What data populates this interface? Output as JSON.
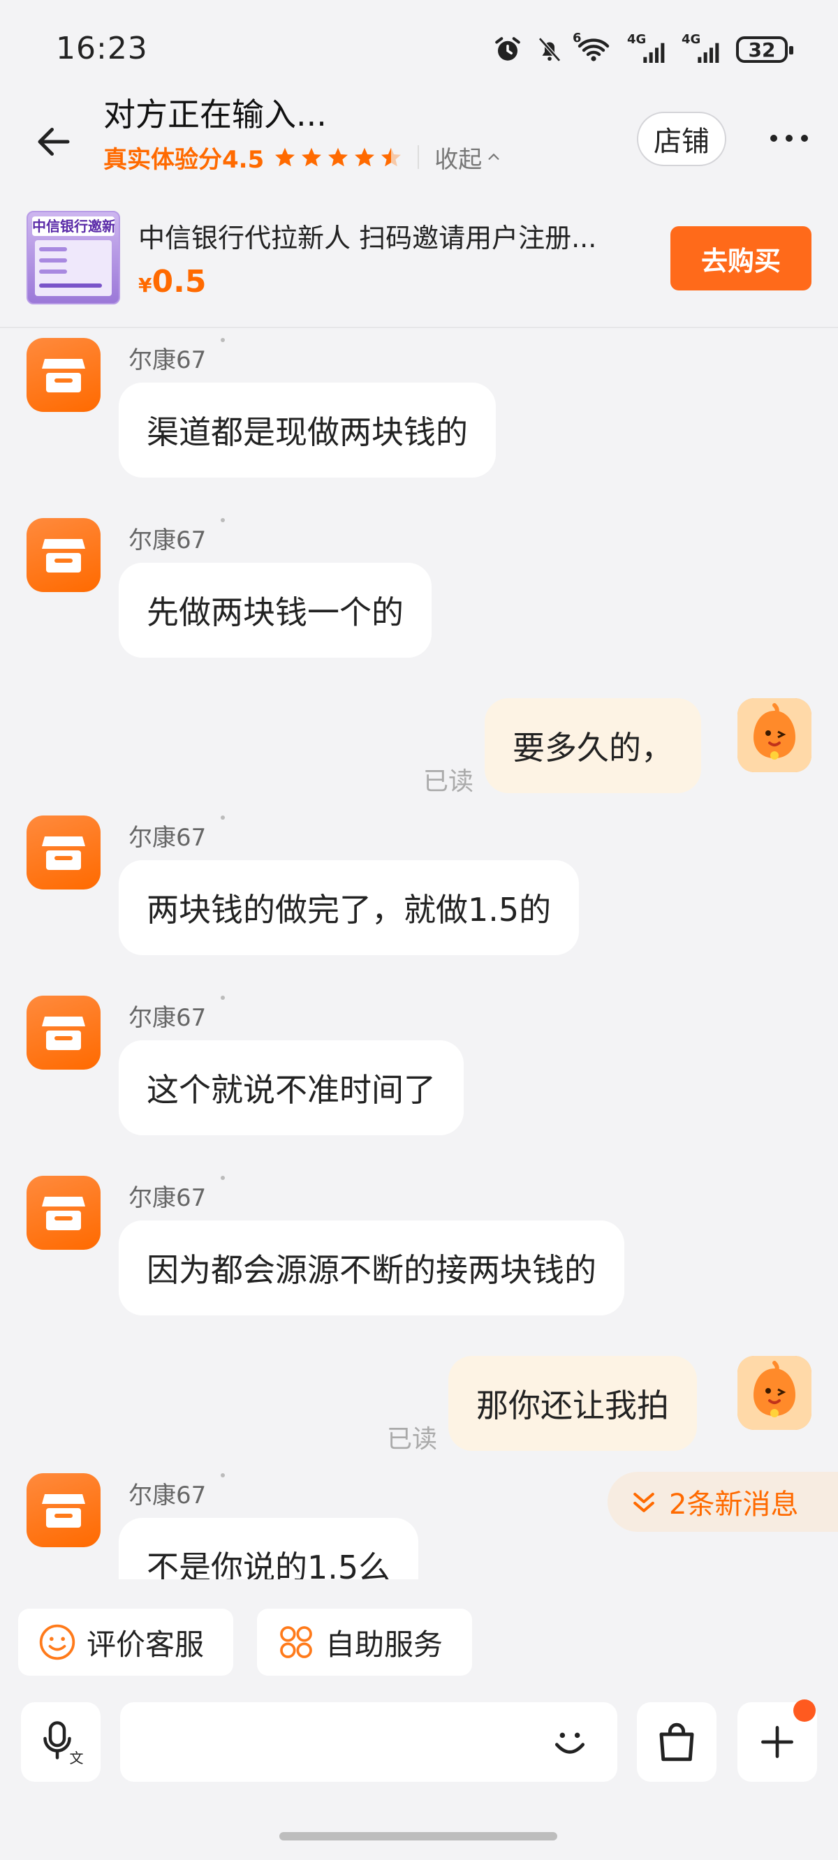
{
  "status_bar": {
    "time": "16:23",
    "network_1": "4G",
    "network_2": "4G",
    "wifi_badge": "6",
    "battery": "32"
  },
  "header": {
    "title": "对方正在输入...",
    "rating_label": "真实体验分4.5",
    "collapse_label": "收起",
    "store_button": "店铺",
    "rating_stars": 4.5
  },
  "product": {
    "thumb_title": "中信银行邀新",
    "title": "中信银行代拉新人 扫码邀请用户注册...",
    "currency": "¥",
    "price": "0.5",
    "buy_button": "去购买"
  },
  "messages": [
    {
      "sender": "尔康67",
      "text": "渠道都是现做两块钱的"
    },
    {
      "sender": "尔康67",
      "text": "先做两块钱一个的"
    },
    {
      "text": "要多久的，",
      "read": "已读"
    },
    {
      "sender": "尔康67",
      "text": "两块钱的做完了，就做1.5的"
    },
    {
      "sender": "尔康67",
      "text": "这个就说不准时间了"
    },
    {
      "sender": "尔康67",
      "text": "因为都会源源不断的接两块钱的"
    },
    {
      "text": "那你还让我拍",
      "read": "已读"
    },
    {
      "sender": "尔康67",
      "text": "不是你说的1.5么"
    }
  ],
  "new_messages_label": "2条新消息",
  "quick_actions": {
    "rate_service": "评价客服",
    "self_service": "自助服务"
  },
  "input": {
    "placeholder": ""
  },
  "colors": {
    "accent": "#ff6a00",
    "outgoing_bubble": "#fdf3e4",
    "background": "#f3f3f5"
  }
}
